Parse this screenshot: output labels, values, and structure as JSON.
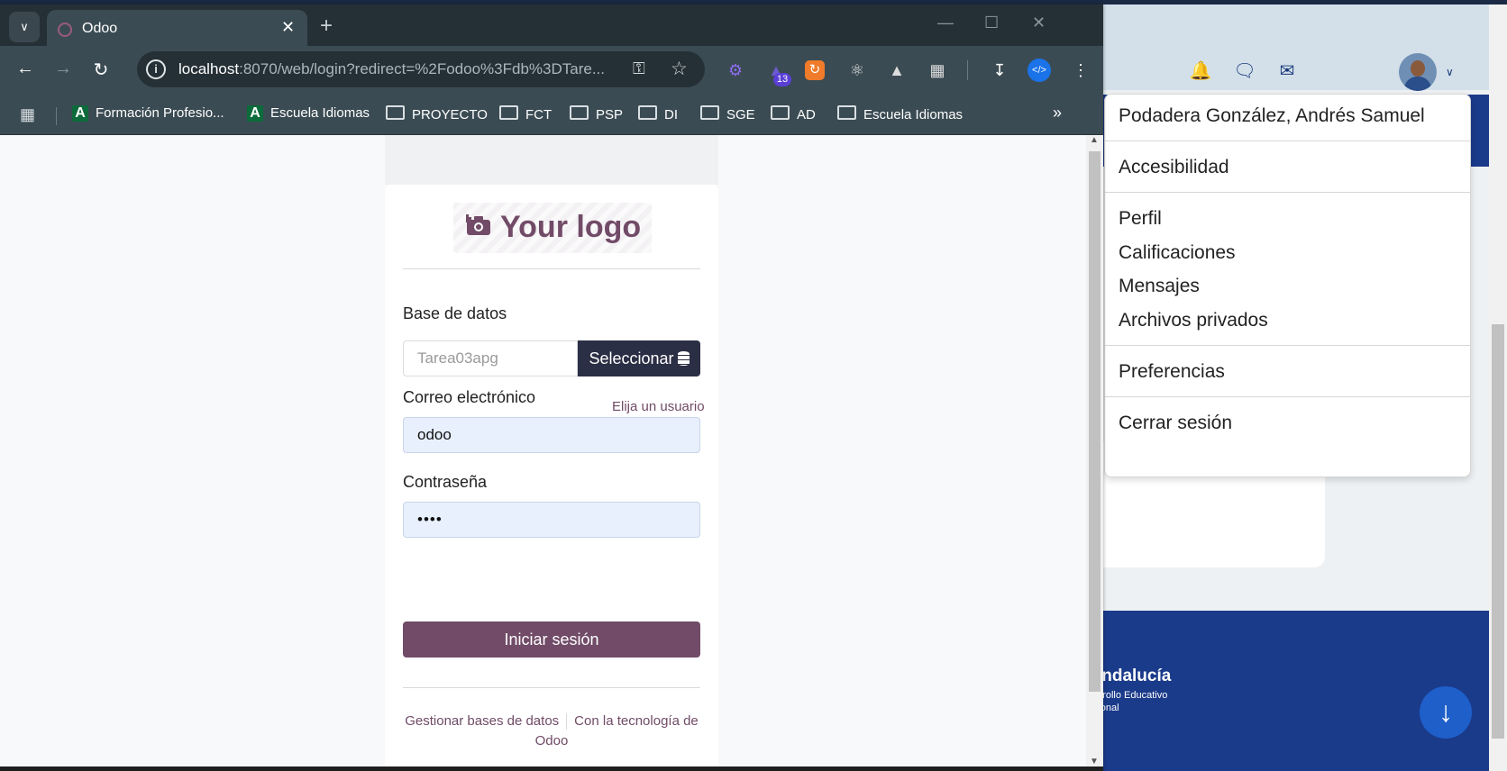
{
  "browser": {
    "tab_title": "Odoo",
    "url_host": "localhost",
    "url_rest": ":8070/web/login?redirect=%2Fodoo%3Fdb%3DTare...",
    "bookmarks": [
      {
        "label": "Formación Profesio...",
        "type": "site"
      },
      {
        "label": "Escuela Idiomas",
        "type": "site"
      },
      {
        "label": "PROYECTO",
        "type": "folder"
      },
      {
        "label": "FCT",
        "type": "folder"
      },
      {
        "label": "PSP",
        "type": "folder"
      },
      {
        "label": "DI",
        "type": "folder"
      },
      {
        "label": "SGE",
        "type": "folder"
      },
      {
        "label": "AD",
        "type": "folder"
      },
      {
        "label": "Escuela Idiomas",
        "type": "folder"
      }
    ],
    "extension_badge": "13"
  },
  "login": {
    "logo_text": "Your logo",
    "database_label": "Base de datos",
    "database_value": "Tarea03apg",
    "select_button": "Seleccionar",
    "email_label": "Correo electrónico",
    "choose_user_link": "Elija un usuario",
    "email_value": "odoo",
    "password_label": "Contraseña",
    "password_value": "••••",
    "login_button": "Iniciar sesión",
    "manage_db_link": "Gestionar bases de datos",
    "powered_by_link": "Con la tecnología de Odoo"
  },
  "user_menu": {
    "user_name": "Podadera González, Andrés Samuel",
    "accessibility": "Accesibilidad",
    "profile": "Perfil",
    "grades": "Calificaciones",
    "messages": "Mensajes",
    "private_files": "Archivos privados",
    "preferences": "Preferencias",
    "logout": "Cerrar sesión"
  },
  "background_page": {
    "footer_title": "nta de Andalucía",
    "footer_sub1": "ejería de Desarrollo Educativo",
    "footer_sub2": "mación Profesional"
  },
  "colors": {
    "odoo_primary": "#714b67",
    "select_button": "#2b2f45",
    "browser_frame": "#3b4b53",
    "background_blue": "#1a3a8a"
  }
}
